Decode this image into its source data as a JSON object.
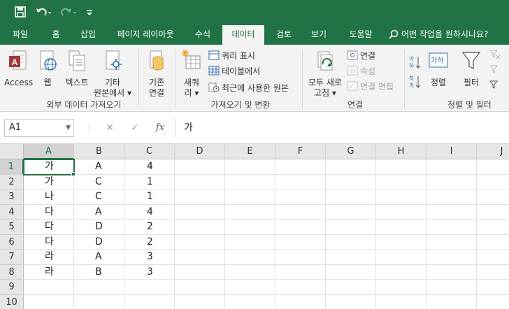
{
  "quick_access": {
    "save_icon": "save-icon",
    "undo_icon": "undo-icon",
    "redo_icon": "redo-icon",
    "customize_icon": "customize-qat-icon"
  },
  "tabs": [
    "파일",
    "홈",
    "삽입",
    "페이지 레이아웃",
    "수식",
    "데이터",
    "검토",
    "보기",
    "도움말"
  ],
  "active_tab": "데이터",
  "tell_me": "어떤 작업을 원하시나요?",
  "ribbon": {
    "get_external": {
      "access": "Access",
      "web": "웹",
      "text": "텍스트",
      "other_line1": "기타",
      "other_line2": "원본에서 ▾",
      "existing_line1": "기존",
      "existing_line2": "연결",
      "label": "외부 데이터 가져오기"
    },
    "transform": {
      "new_query_line1": "새쿼",
      "new_query_line2": "리 ▾",
      "show_queries": "쿼리 표시",
      "from_table": "테이블에서",
      "recent_sources": "최근에 사용한 원본",
      "label": "가져오기 및 변환"
    },
    "connections": {
      "refresh_line1": "모두 새로",
      "refresh_line2": "고침 ▾",
      "connections": "연결",
      "properties": "속성",
      "edit_links": "연결 편집",
      "label": "연결"
    },
    "sort_filter": {
      "sort": "정렬",
      "filter": "필터",
      "label": "정렬 및 필터"
    }
  },
  "formula_bar": {
    "name_box": "A1",
    "cancel": "✕",
    "enter": "✓",
    "fx": "fx",
    "content": "가"
  },
  "sheet": {
    "columns": [
      "A",
      "B",
      "C",
      "D",
      "E",
      "F",
      "G",
      "H",
      "I",
      "J"
    ],
    "selected_cell": "A1",
    "rows": [
      {
        "n": "1",
        "a": "가",
        "b": "A",
        "c": "4"
      },
      {
        "n": "2",
        "a": "가",
        "b": "C",
        "c": "1"
      },
      {
        "n": "3",
        "a": "나",
        "b": "C",
        "c": "1"
      },
      {
        "n": "4",
        "a": "다",
        "b": "A",
        "c": "4"
      },
      {
        "n": "5",
        "a": "다",
        "b": "D",
        "c": "2"
      },
      {
        "n": "6",
        "a": "다",
        "b": "D",
        "c": "2"
      },
      {
        "n": "7",
        "a": "라",
        "b": "A",
        "c": "3"
      },
      {
        "n": "8",
        "a": "라",
        "b": "B",
        "c": "3"
      },
      {
        "n": "9",
        "a": "",
        "b": "",
        "c": ""
      },
      {
        "n": "10",
        "a": "",
        "b": "",
        "c": ""
      }
    ]
  },
  "colors": {
    "accent": "#217346",
    "ribbon_bg": "#f3f3f3",
    "header_bg": "#e6e6e6"
  }
}
